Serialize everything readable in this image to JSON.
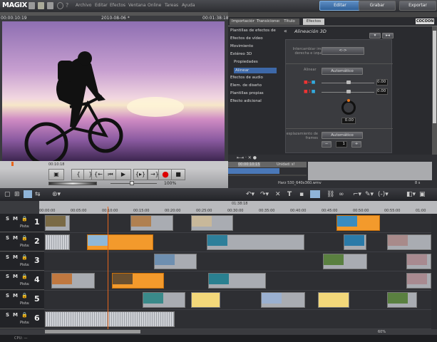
{
  "menubar": {
    "logo": "MAGIX",
    "menus": [
      "Archivo",
      "Editar",
      "Efectos",
      "Ventana",
      "Online",
      "Tareas",
      "Ayuda"
    ],
    "modes": [
      {
        "label": "Editar",
        "active": true
      },
      {
        "label": "Grabar",
        "active": false
      },
      {
        "label": "Exportar",
        "active": false
      }
    ]
  },
  "preview": {
    "current_time": "00:00:10:19",
    "project_title": "2010-08-06 *",
    "total_time": "00:01:38:18",
    "ruler_time": "00:10:18",
    "zoom": "100%"
  },
  "right_panel": {
    "tabs": [
      "Importación",
      "Transiciones",
      "Título",
      "Efectos"
    ],
    "active_tab": "Efectos",
    "brand": "COCOON",
    "effects_list": [
      {
        "label": "Plantillas de efectos de"
      },
      {
        "label": "Efectos de vídeo"
      },
      {
        "label": "Movimiento"
      },
      {
        "label": "Estéreo 3D"
      },
      {
        "label": "Propiedades",
        "sub": true
      },
      {
        "label": "Alinear",
        "sub": true,
        "selected": true
      },
      {
        "label": "Efectos de audio"
      },
      {
        "label": "Elem. de diseño"
      },
      {
        "label": "Plantillas propias"
      },
      {
        "label": "Efecto adicional"
      }
    ],
    "effect_title": "Alineación 3D",
    "swap_label": "Intercambiar imagen derecha e izquierda",
    "swap_button": "<->",
    "align_label": "Alinear",
    "align_button": "Automático",
    "horizontal_value": "0.00",
    "vertical_value": "0.00",
    "rotation_value": "0.00",
    "frame_offset_label": "esplazamiento de frames",
    "frame_offset_button": "Automático",
    "frame_offset_value": "1",
    "minus": "−",
    "plus": "+"
  },
  "mini_timeline": {
    "time": "00:00:10:15",
    "unit": "Unidad: s!",
    "filename": "Harz 530_640x360.wmv",
    "duration": "8 s"
  },
  "timeline": {
    "position_label": "01:38:18",
    "ruler": [
      "00:00:00",
      "00:05:00",
      "00:10:00",
      "00:15:00",
      "00:20:00",
      "00:25:00",
      "00:30:00",
      "00:35:00",
      "00:40:00",
      "00:45:00",
      "00:50:00",
      "00:55:00",
      "01:00"
    ],
    "playhead_seconds": 10,
    "tracks": [
      {
        "number": "1",
        "label": "Pista:",
        "s": "S",
        "m": "M"
      },
      {
        "number": "2",
        "label": "Pista:",
        "s": "S",
        "m": "M"
      },
      {
        "number": "3",
        "label": "Pista:",
        "s": "S",
        "m": "M"
      },
      {
        "number": "4",
        "label": "Pista:",
        "s": "S",
        "m": "M"
      },
      {
        "number": "5",
        "label": "Pista:",
        "s": "S",
        "m": "M"
      },
      {
        "number": "6",
        "label": "Pista:",
        "s": "S",
        "m": "M"
      }
    ],
    "clips": [
      {
        "track": 0,
        "start": 0,
        "end": 4,
        "kind": "img",
        "thumb": "#7a6a45"
      },
      {
        "track": 0,
        "start": 13.6,
        "end": 20.5,
        "kind": "img",
        "thumb": "#b08050"
      },
      {
        "track": 0,
        "start": 23.3,
        "end": 30,
        "kind": "img",
        "thumb": "#c8b89a"
      },
      {
        "track": 0,
        "start": 46.5,
        "end": 53.4,
        "kind": "sel",
        "thumb": "#3a8cc0"
      },
      {
        "track": 1,
        "start": 0,
        "end": 4,
        "kind": "audio"
      },
      {
        "track": 1,
        "start": 6.7,
        "end": 17.3,
        "kind": "sel",
        "thumb": "#8fb8d8"
      },
      {
        "track": 1,
        "start": 25.8,
        "end": 41.4,
        "kind": "img",
        "thumb": "#2d7f9a"
      },
      {
        "track": 1,
        "start": 47.6,
        "end": 51.3,
        "kind": "img",
        "thumb": "#2a7aa8"
      },
      {
        "track": 1,
        "start": 54.5,
        "end": 61.6,
        "kind": "img",
        "thumb": "#a88a8a"
      },
      {
        "track": 2,
        "start": 17.4,
        "end": 24.2,
        "kind": "img",
        "thumb": "#6e8fb0"
      },
      {
        "track": 2,
        "start": 44.3,
        "end": 51.4,
        "kind": "img",
        "thumb": "#5a8040"
      },
      {
        "track": 2,
        "start": 57.6,
        "end": 61.6,
        "kind": "img",
        "thumb": "#a88a90"
      },
      {
        "track": 3,
        "start": 1,
        "end": 8,
        "kind": "img",
        "thumb": "#c07840"
      },
      {
        "track": 3,
        "start": 10.7,
        "end": 19,
        "kind": "sel",
        "thumb": "#6a5030"
      },
      {
        "track": 3,
        "start": 26,
        "end": 35.2,
        "kind": "img",
        "thumb": "#2a8090"
      },
      {
        "track": 3,
        "start": 57.6,
        "end": 61.6,
        "kind": "img",
        "thumb": "#a88a90"
      },
      {
        "track": 4,
        "start": 15.6,
        "end": 22.4,
        "kind": "img",
        "thumb": "#3a8a8a"
      },
      {
        "track": 4,
        "start": 23.3,
        "end": 28,
        "kind": "yellow"
      },
      {
        "track": 4,
        "start": 34.4,
        "end": 41.5,
        "kind": "img",
        "thumb": "#9ab0d0"
      },
      {
        "track": 4,
        "start": 43.5,
        "end": 48.5,
        "kind": "yellow"
      },
      {
        "track": 4,
        "start": 54.5,
        "end": 59.3,
        "kind": "img",
        "thumb": "#5a8040"
      },
      {
        "track": 5,
        "start": 0,
        "end": 20.7,
        "kind": "audio"
      }
    ],
    "zoom": "60%"
  },
  "status": {
    "cpu": "CPU: —"
  }
}
